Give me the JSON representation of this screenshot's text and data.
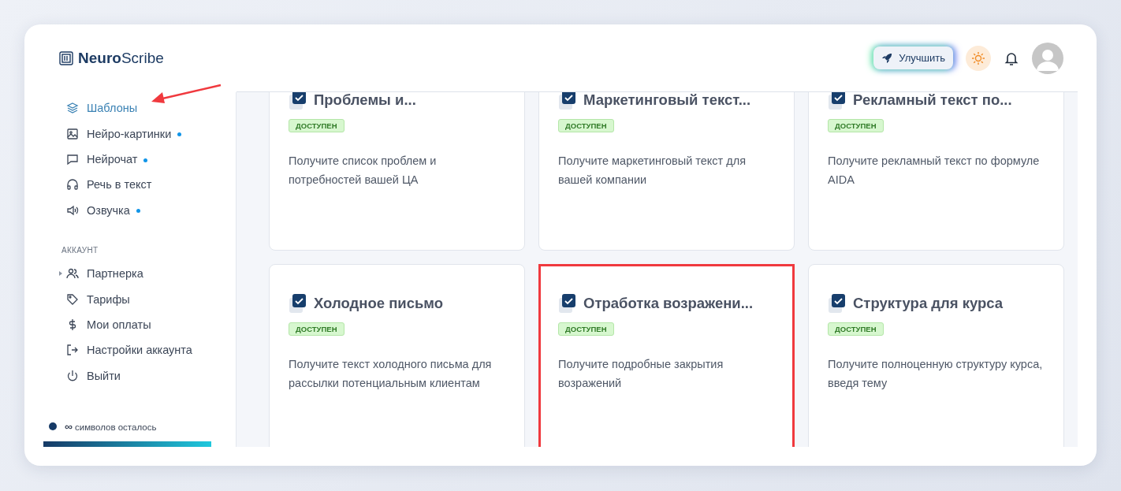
{
  "logo": {
    "bold": "Neuro",
    "rest": "Scribe"
  },
  "header": {
    "upgrade_button": "Улучшить"
  },
  "sidebar": {
    "items": [
      {
        "label": "Шаблоны",
        "selected": true,
        "dot": false
      },
      {
        "label": "Нейро-картинки",
        "selected": false,
        "dot": true
      },
      {
        "label": "Нейрочат",
        "selected": false,
        "dot": true
      },
      {
        "label": "Речь в текст",
        "selected": false,
        "dot": false
      },
      {
        "label": "Озвучка",
        "selected": false,
        "dot": true
      }
    ],
    "section_title": "АККАУНТ",
    "account_items": [
      {
        "label": "Партнерка",
        "selected": false,
        "expanded": false
      },
      {
        "label": "Тарифы",
        "selected": false
      },
      {
        "label": "Мои оплаты",
        "selected": false
      },
      {
        "label": "Настройки аккаунта",
        "selected": false
      },
      {
        "label": "Выйти",
        "selected": false
      }
    ],
    "quota": {
      "amount": "∞",
      "label": "символов осталось",
      "level": 1
    }
  },
  "cards": [
    {
      "title": "Проблемы и...",
      "badge": "ДОСТУПЕН",
      "description": "Получите список проблем и потребностей вашей ЦА",
      "highlighted": false
    },
    {
      "title": "Маркетинговый текст...",
      "badge": "ДОСТУПЕН",
      "description": "Получите маркетинговый текст для вашей компании",
      "highlighted": false
    },
    {
      "title": "Рекламный текст по...",
      "badge": "ДОСТУПЕН",
      "description": "Получите рекламный текст по формуле AIDA",
      "highlighted": false
    },
    {
      "title": "Холодное письмо",
      "badge": "ДОСТУПЕН",
      "description": "Получите текст холодного письма для рассылки потенциальным клиентам",
      "highlighted": false
    },
    {
      "title": "Отработка возражени...",
      "badge": "ДОСТУПЕН",
      "description": "Получите подробные закрытия возражений",
      "highlighted": true
    },
    {
      "title": "Структура для курса",
      "badge": "ДОСТУПЕН",
      "description": "Получите полноценную структуру курса, введя тему",
      "highlighted": false
    }
  ]
}
